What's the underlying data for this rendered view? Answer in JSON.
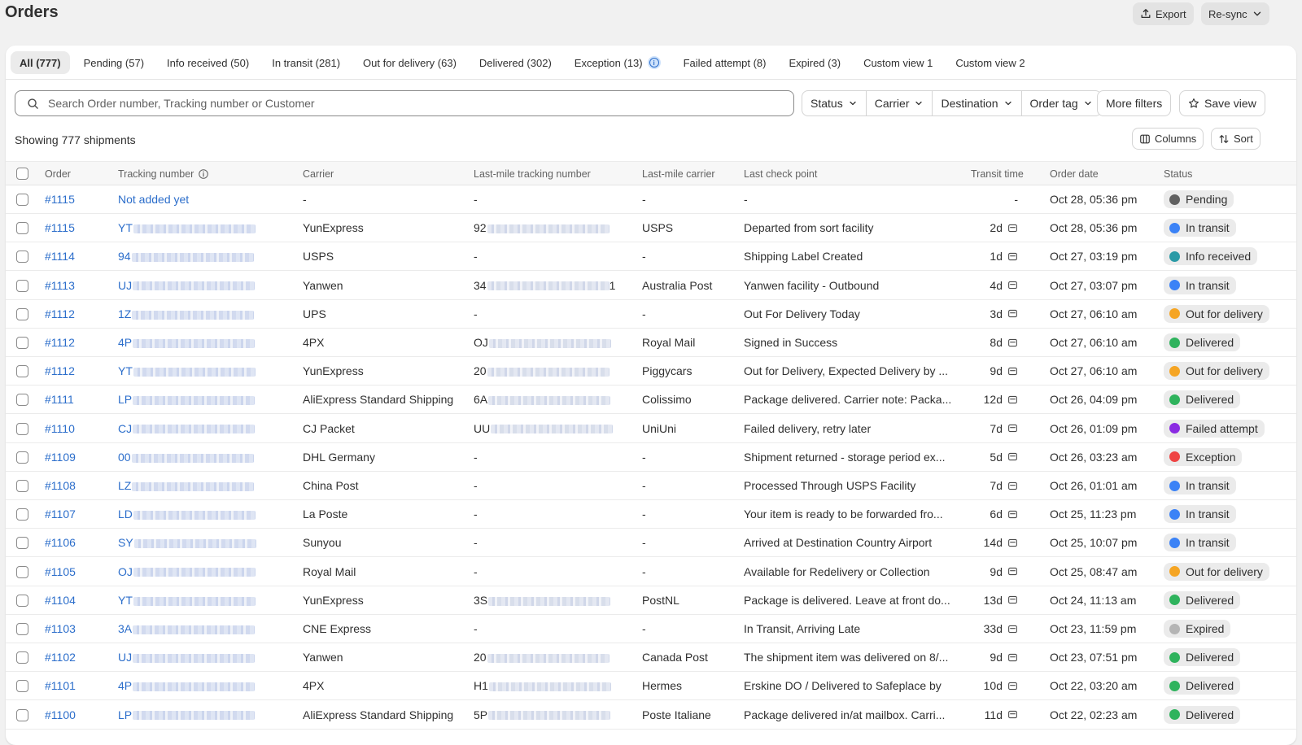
{
  "header": {
    "title": "Orders",
    "export_label": "Export",
    "resync_label": "Re-sync"
  },
  "tabs": [
    {
      "label": "All (777)",
      "active": true
    },
    {
      "label": "Pending (57)"
    },
    {
      "label": "Info received (50)"
    },
    {
      "label": "In transit (281)"
    },
    {
      "label": "Out for delivery (63)"
    },
    {
      "label": "Delivered (302)"
    },
    {
      "label": "Exception (13)",
      "info_icon": true
    },
    {
      "label": "Failed attempt (8)"
    },
    {
      "label": "Expired (3)"
    },
    {
      "label": "Custom view 1"
    },
    {
      "label": "Custom view 2"
    }
  ],
  "search": {
    "placeholder": "Search Order number, Tracking number or Customer",
    "value": ""
  },
  "filters": [
    "Status",
    "Carrier",
    "Destination",
    "Order tag"
  ],
  "more_filters_label": "More filters",
  "save_view_label": "Save view",
  "showing_text": "Showing 777 shipments",
  "columns_label": "Columns",
  "sort_label": "Sort",
  "table": {
    "headers": {
      "order": "Order",
      "tracking": "Tracking number",
      "carrier": "Carrier",
      "lastmile_tracking": "Last-mile tracking number",
      "lastmile_carrier": "Last-mile carrier",
      "checkpoint": "Last check point",
      "transit": "Transit time",
      "date": "Order date",
      "status": "Status"
    },
    "rows": [
      {
        "order": "#1115",
        "tracking": "Not added yet",
        "tracking_redacted": false,
        "carrier": "-",
        "lm_tracking": "-",
        "lm_redacted": false,
        "lm_carrier": "-",
        "checkpoint": "-",
        "transit": "-",
        "transit_icon": false,
        "date": "Oct 28, 05:36 pm",
        "status": "Pending"
      },
      {
        "order": "#1115",
        "tracking": "YT",
        "tracking_redacted": true,
        "carrier": "YunExpress",
        "lm_tracking": "92",
        "lm_redacted": true,
        "lm_carrier": "USPS",
        "checkpoint": "Departed from sort facility",
        "transit": "2d",
        "transit_icon": true,
        "date": "Oct 28, 05:36 pm",
        "status": "In transit"
      },
      {
        "order": "#1114",
        "tracking": "94",
        "tracking_redacted": true,
        "carrier": "USPS",
        "lm_tracking": "-",
        "lm_redacted": false,
        "lm_carrier": "-",
        "checkpoint": "Shipping Label Created",
        "transit": "1d",
        "transit_icon": true,
        "date": "Oct 27, 03:19 pm",
        "status": "Info received"
      },
      {
        "order": "#1113",
        "tracking": "UJ",
        "tracking_redacted": true,
        "carrier": "Yanwen",
        "lm_tracking": "34",
        "lm_redacted": true,
        "lm_suffix": "1",
        "lm_carrier": "Australia Post",
        "checkpoint": "Yanwen facility - Outbound",
        "transit": "4d",
        "transit_icon": true,
        "date": "Oct 27, 03:07 pm",
        "status": "In transit"
      },
      {
        "order": "#1112",
        "tracking": "1Z",
        "tracking_redacted": true,
        "carrier": "UPS",
        "lm_tracking": "-",
        "lm_redacted": false,
        "lm_carrier": "-",
        "checkpoint": "Out For Delivery Today",
        "transit": "3d",
        "transit_icon": true,
        "date": "Oct 27, 06:10 am",
        "status": "Out for delivery"
      },
      {
        "order": "#1112",
        "tracking": "4P",
        "tracking_redacted": true,
        "carrier": "4PX",
        "lm_tracking": "OJ",
        "lm_redacted": true,
        "lm_carrier": "Royal Mail",
        "checkpoint": "Signed in Success",
        "transit": "8d",
        "transit_icon": true,
        "date": "Oct 27, 06:10 am",
        "status": "Delivered"
      },
      {
        "order": "#1112",
        "tracking": "YT",
        "tracking_redacted": true,
        "carrier": "YunExpress",
        "lm_tracking": "20",
        "lm_redacted": true,
        "lm_carrier": "Piggycars",
        "checkpoint": "Out for Delivery, Expected Delivery by ...",
        "transit": "9d",
        "transit_icon": true,
        "date": "Oct 27, 06:10 am",
        "status": "Out for delivery"
      },
      {
        "order": "#1111",
        "tracking": "LP",
        "tracking_redacted": true,
        "carrier": "AliExpress Standard Shipping",
        "lm_tracking": "6A",
        "lm_redacted": true,
        "lm_carrier": "Colissimo",
        "checkpoint": "Package delivered. Carrier note: Packa...",
        "transit": "12d",
        "transit_icon": true,
        "date": "Oct 26, 04:09 pm",
        "status": "Delivered"
      },
      {
        "order": "#1110",
        "tracking": "CJ",
        "tracking_redacted": true,
        "carrier": "CJ Packet",
        "lm_tracking": "UU",
        "lm_redacted": true,
        "lm_carrier": "UniUni",
        "checkpoint": "Failed delivery, retry later",
        "transit": "7d",
        "transit_icon": true,
        "date": "Oct 26, 01:09 pm",
        "status": "Failed attempt"
      },
      {
        "order": "#1109",
        "tracking": "00",
        "tracking_redacted": true,
        "carrier": "DHL Germany",
        "lm_tracking": "-",
        "lm_redacted": false,
        "lm_carrier": "-",
        "checkpoint": "Shipment returned - storage period ex...",
        "transit": "5d",
        "transit_icon": true,
        "date": "Oct 26, 03:23 am",
        "status": "Exception"
      },
      {
        "order": "#1108",
        "tracking": "LZ",
        "tracking_redacted": true,
        "carrier": "China Post",
        "lm_tracking": "-",
        "lm_redacted": false,
        "lm_carrier": "-",
        "checkpoint": "Processed Through USPS Facility",
        "transit": "7d",
        "transit_icon": true,
        "date": "Oct 26, 01:01 am",
        "status": "In transit"
      },
      {
        "order": "#1107",
        "tracking": "LD",
        "tracking_redacted": true,
        "carrier": "La Poste",
        "lm_tracking": "-",
        "lm_redacted": false,
        "lm_carrier": "-",
        "checkpoint": "Your item is ready to be forwarded fro...",
        "transit": "6d",
        "transit_icon": true,
        "date": "Oct 25, 11:23 pm",
        "status": "In transit"
      },
      {
        "order": "#1106",
        "tracking": "SY",
        "tracking_redacted": true,
        "carrier": "Sunyou",
        "lm_tracking": "-",
        "lm_redacted": false,
        "lm_carrier": "-",
        "checkpoint": "Arrived at Destination Country Airport",
        "transit": "14d",
        "transit_icon": true,
        "date": "Oct 25, 10:07 pm",
        "status": "In transit"
      },
      {
        "order": "#1105",
        "tracking": "OJ",
        "tracking_redacted": true,
        "carrier": "Royal Mail",
        "lm_tracking": "-",
        "lm_redacted": false,
        "lm_carrier": "-",
        "checkpoint": "Available for Redelivery or Collection",
        "transit": "9d",
        "transit_icon": true,
        "date": "Oct 25, 08:47 am",
        "status": "Out for delivery"
      },
      {
        "order": "#1104",
        "tracking": "YT",
        "tracking_redacted": true,
        "carrier": "YunExpress",
        "lm_tracking": "3S",
        "lm_redacted": true,
        "lm_carrier": "PostNL",
        "checkpoint": "Package is delivered. Leave at front do...",
        "transit": "13d",
        "transit_icon": true,
        "date": "Oct 24, 11:13 am",
        "status": "Delivered"
      },
      {
        "order": "#1103",
        "tracking": "3A",
        "tracking_redacted": true,
        "carrier": "CNE Express",
        "lm_tracking": "-",
        "lm_redacted": false,
        "lm_carrier": "-",
        "checkpoint": "In Transit, Arriving Late",
        "transit": "33d",
        "transit_icon": true,
        "date": "Oct 23, 11:59 pm",
        "status": "Expired"
      },
      {
        "order": "#1102",
        "tracking": "UJ",
        "tracking_redacted": true,
        "carrier": "Yanwen",
        "lm_tracking": "20",
        "lm_redacted": true,
        "lm_carrier": "Canada Post",
        "checkpoint": "The shipment item was delivered on 8/...",
        "transit": "9d",
        "transit_icon": true,
        "date": "Oct 23, 07:51 pm",
        "status": "Delivered"
      },
      {
        "order": "#1101",
        "tracking": "4P",
        "tracking_redacted": true,
        "carrier": "4PX",
        "lm_tracking": "H1",
        "lm_redacted": true,
        "lm_carrier": "Hermes",
        "checkpoint": "Erskine DO / Delivered to Safeplace by",
        "transit": "10d",
        "transit_icon": true,
        "date": "Oct 22, 03:20 am",
        "status": "Delivered"
      },
      {
        "order": "#1100",
        "tracking": "LP",
        "tracking_redacted": true,
        "carrier": "AliExpress Standard Shipping",
        "lm_tracking": "5P",
        "lm_redacted": true,
        "lm_carrier": "Poste Italiane",
        "checkpoint": "Package delivered in/at mailbox. Carri...",
        "transit": "11d",
        "transit_icon": true,
        "date": "Oct 22, 02:23 am",
        "status": "Delivered"
      }
    ]
  },
  "status_colors": {
    "Pending": "#616161",
    "In transit": "#3b82f6",
    "Info received": "#2a9aa6",
    "Out for delivery": "#f5a524",
    "Delivered": "#2fb35d",
    "Failed attempt": "#8a2be2",
    "Exception": "#ef4444",
    "Expired": "#b5b5b5"
  },
  "accent_color": "#2c6ecb"
}
